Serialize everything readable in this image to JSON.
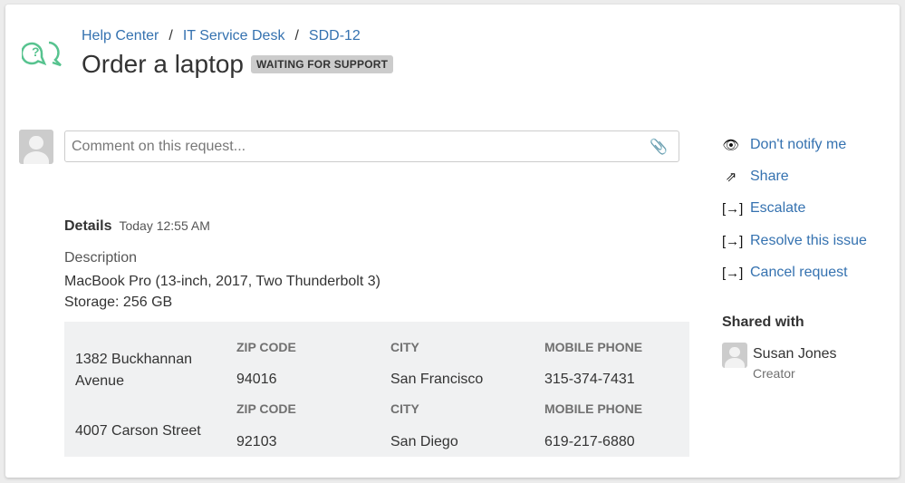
{
  "breadcrumb": [
    "Help Center",
    "IT Service Desk",
    "SDD-12"
  ],
  "title": "Order a laptop",
  "status": "WAITING FOR SUPPORT",
  "comment": {
    "placeholder": "Comment on this request..."
  },
  "details": {
    "label": "Details",
    "time": "Today 12:55 AM",
    "description_label": "Description",
    "description_lines": [
      "MacBook Pro (13-inch, 2017, Two Thunderbolt 3)",
      "Storage: 256 GB"
    ]
  },
  "table": {
    "headers": {
      "zip": "ZIP CODE",
      "city": "CITY",
      "phone": "MOBILE PHONE"
    },
    "rows": [
      {
        "address": "1382 Buckhannan Avenue",
        "zip": "94016",
        "city": "San Francisco",
        "phone": "315-374-7431"
      },
      {
        "address": "4007 Carson Street",
        "zip": "92103",
        "city": "San Diego",
        "phone": "619-217-6880"
      }
    ]
  },
  "actions": [
    {
      "label": "Don't notify me",
      "icon": "eye-icon"
    },
    {
      "label": "Share",
      "icon": "share-icon"
    },
    {
      "label": "Escalate",
      "icon": "transition-icon"
    },
    {
      "label": "Resolve this issue",
      "icon": "transition-icon"
    },
    {
      "label": "Cancel request",
      "icon": "transition-icon"
    }
  ],
  "shared_with": {
    "label": "Shared with",
    "name": "Susan Jones",
    "role": "Creator"
  },
  "colors": {
    "link": "#3572b0",
    "logo": "#57c38f"
  }
}
